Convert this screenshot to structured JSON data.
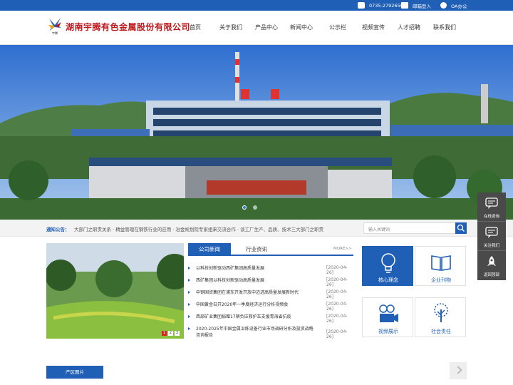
{
  "topbar": {
    "phone": "0735-2792656",
    "mail_label": "邮箱登入",
    "oa_label": "OA办公"
  },
  "header": {
    "brand": "湖南宇腾有色金属股份有限公司",
    "logo_text": "宇腾"
  },
  "nav": {
    "items": [
      "首页",
      "关于我们",
      "产品中心",
      "新闻中心",
      "公示栏",
      "视频宣传",
      "人才招聘",
      "联系我们"
    ]
  },
  "notice": {
    "label": "通知公告：",
    "text": "大部门之职责关系 · 精益管理在钢铁行业的应用 · 冶金规划院专家组来交流合作 · 谈工厂生产、品质、技术三大部门之职责",
    "search_placeholder": "输入关键词"
  },
  "news": {
    "tab_active": "公司新闻",
    "tab_inactive": "行业资讯",
    "more": "MORE>>",
    "items": [
      {
        "title": "以科技创新驱动西矿集团高质量发展",
        "date": "[2020-04-26]"
      },
      {
        "title": "西矿集团以科技创新驱动高质量发展",
        "date": "[2020-04-26]"
      },
      {
        "title": "中钢国贸集团在浦东开发开放中迈进高质量发展新时代",
        "date": "[2020-04-26]"
      },
      {
        "title": "中国黄金召开2020年一季度经济运行分析视频会",
        "date": "[2020-04-26]"
      },
      {
        "title": "西部矿业集团捐赠17辆负压救护车支援青海省抗疫",
        "date": "[2020-04-26]"
      },
      {
        "title": "2020-2025年中国金属冶炼设备行业市场调研分析及投资战略咨询报告",
        "date": "[2020-04-26]"
      }
    ],
    "pager": [
      "1",
      "2",
      "3"
    ]
  },
  "tiles": {
    "items": [
      "核心理念",
      "企业刊物",
      "视频展示",
      "社会责任"
    ]
  },
  "sidebar": {
    "items": [
      "在线咨询",
      "关注我们",
      "返回顶部"
    ]
  },
  "products": {
    "button": "产区图片"
  },
  "colors": {
    "primary": "#1f5fb5",
    "brand_red": "#c0191c",
    "side_gray": "#4a4a4a"
  }
}
